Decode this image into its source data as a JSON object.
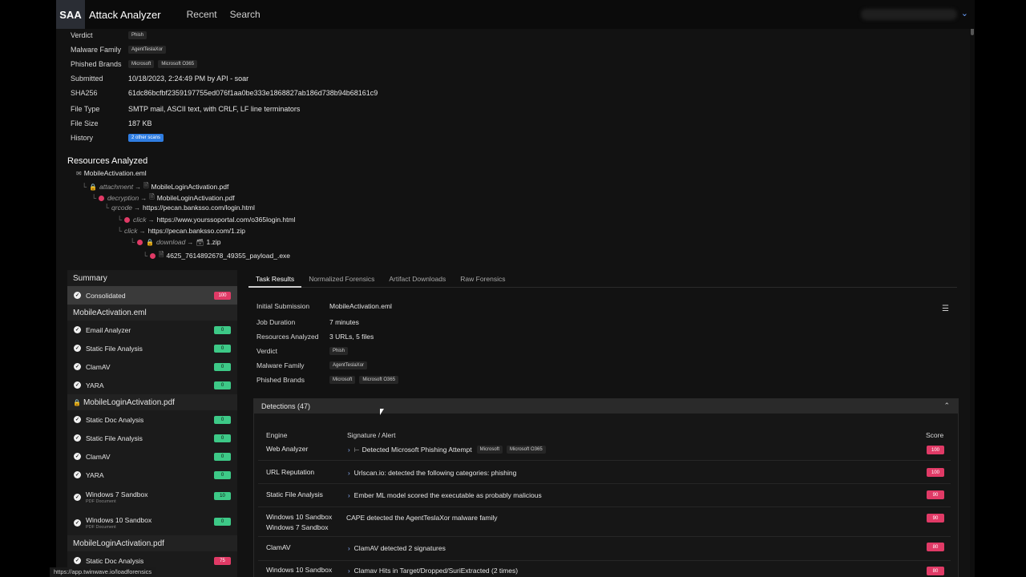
{
  "topbar": {
    "logo": "SAA",
    "app_title": "Attack Analyzer",
    "nav": [
      "Recent",
      "Search"
    ]
  },
  "meta": {
    "verdict_label": "Verdict",
    "verdict": "Phish",
    "malware_label": "Malware Family",
    "malware": "AgentTeslaXor",
    "brands_label": "Phished Brands",
    "brands": [
      "Microsoft",
      "Microsoft O365"
    ],
    "submitted_label": "Submitted",
    "submitted": "10/18/2023, 2:24:49 PM by API - soar",
    "sha_label": "SHA256",
    "sha": "61dc86bcfbf2359197755ed076f1aa0be333e1868827ab186d738b94b68161c9",
    "filetype_label": "File Type",
    "filetype": "SMTP mail, ASCII text, with CRLF, LF line terminators",
    "filesize_label": "File Size",
    "filesize": "187 KB",
    "history_label": "History",
    "history": "2 other scans"
  },
  "resources": {
    "title": "Resources Analyzed",
    "nodes": [
      {
        "edge": "",
        "name": "MobileActivation.eml"
      },
      {
        "edge": "attachment",
        "name": "MobileLoginActivation.pdf"
      },
      {
        "edge": "decryption",
        "name": "MobileLoginActivation.pdf"
      },
      {
        "edge": "qrcode",
        "name": "https://pecan.banksso.com/login.html"
      },
      {
        "edge": "click",
        "name": "https://www.yourssoportal.com/o365login.html"
      },
      {
        "edge": "click",
        "name": "https://pecan.banksso.com/1.zip"
      },
      {
        "edge": "download",
        "name": "1.zip"
      },
      {
        "edge": "",
        "name": "4625_7614892678_49355_payload_.exe"
      }
    ]
  },
  "sidebar": {
    "summary": "Summary",
    "consolidated": {
      "label": "Consolidated",
      "score": "100"
    },
    "sections": [
      {
        "title": "MobileActivation.eml",
        "items": [
          {
            "label": "Email Analyzer",
            "sub": "",
            "score": "0"
          },
          {
            "label": "Static File Analysis",
            "sub": "",
            "score": "0"
          },
          {
            "label": "ClamAV",
            "sub": "",
            "score": "0"
          },
          {
            "label": "YARA",
            "sub": "",
            "score": "0"
          }
        ]
      },
      {
        "title": "MobileLoginActivation.pdf",
        "items": [
          {
            "label": "Static Doc Analysis",
            "sub": "",
            "score": "0"
          },
          {
            "label": "Static File Analysis",
            "sub": "",
            "score": "0"
          },
          {
            "label": "ClamAV",
            "sub": "",
            "score": "0"
          },
          {
            "label": "YARA",
            "sub": "",
            "score": "0"
          },
          {
            "label": "Windows 7 Sandbox",
            "sub": "PDF Document",
            "score": "10"
          },
          {
            "label": "Windows 10 Sandbox",
            "sub": "PDF Document",
            "score": "0"
          }
        ]
      },
      {
        "title": "MobileLoginActivation.pdf",
        "items": [
          {
            "label": "Static Doc Analysis",
            "sub": "",
            "score": "75"
          }
        ]
      }
    ]
  },
  "tabs": [
    "Task Results",
    "Normalized Forensics",
    "Artifact Downloads",
    "Raw Forensics"
  ],
  "task": {
    "initial_label": "Initial Submission",
    "initial": "MobileActivation.eml",
    "duration_label": "Job Duration",
    "duration": "7 minutes",
    "resources_label": "Resources Analyzed",
    "resources": "3 URLs, 5 files",
    "verdict_label": "Verdict",
    "verdict": "Phish",
    "malware_label": "Malware Family",
    "malware": "AgentTeslaXor",
    "brands_label": "Phished Brands",
    "brands": [
      "Microsoft",
      "Microsoft O365"
    ]
  },
  "detections": {
    "title": "Detections (47)",
    "col_engine": "Engine",
    "col_signature": "Signature / Alert",
    "col_score": "Score",
    "rows": [
      {
        "engine": "Web Analyzer",
        "engine2": "",
        "signature": "Detected Microsoft Phishing Attempt",
        "tags": [
          "Microsoft",
          "Microsoft O365"
        ],
        "score": "100"
      },
      {
        "engine": "URL Reputation",
        "engine2": "",
        "signature": "Urlscan.io: detected the following categories: phishing",
        "tags": [],
        "score": "100"
      },
      {
        "engine": "Static File Analysis",
        "engine2": "",
        "signature": "Ember ML model scored the executable as probably malicious",
        "tags": [],
        "score": "90"
      },
      {
        "engine": "Windows 10 Sandbox",
        "engine2": "Windows 7 Sandbox",
        "signature": "CAPE detected the AgentTeslaXor malware family",
        "tags": [],
        "score": "90"
      },
      {
        "engine": "ClamAV",
        "engine2": "",
        "signature": "ClamAV detected 2 signatures",
        "tags": [],
        "score": "80"
      },
      {
        "engine": "Windows 10 Sandbox",
        "engine2": "",
        "signature": "Clamav Hits in Target/Dropped/SuriExtracted (2 times)",
        "tags": [],
        "score": "80"
      }
    ]
  },
  "status_url": "https://app.twinwave.io/loadforensics",
  "colors": {
    "accent_red": "#e03a66",
    "accent_green": "#3dc987",
    "accent_blue": "#2f7de1"
  }
}
